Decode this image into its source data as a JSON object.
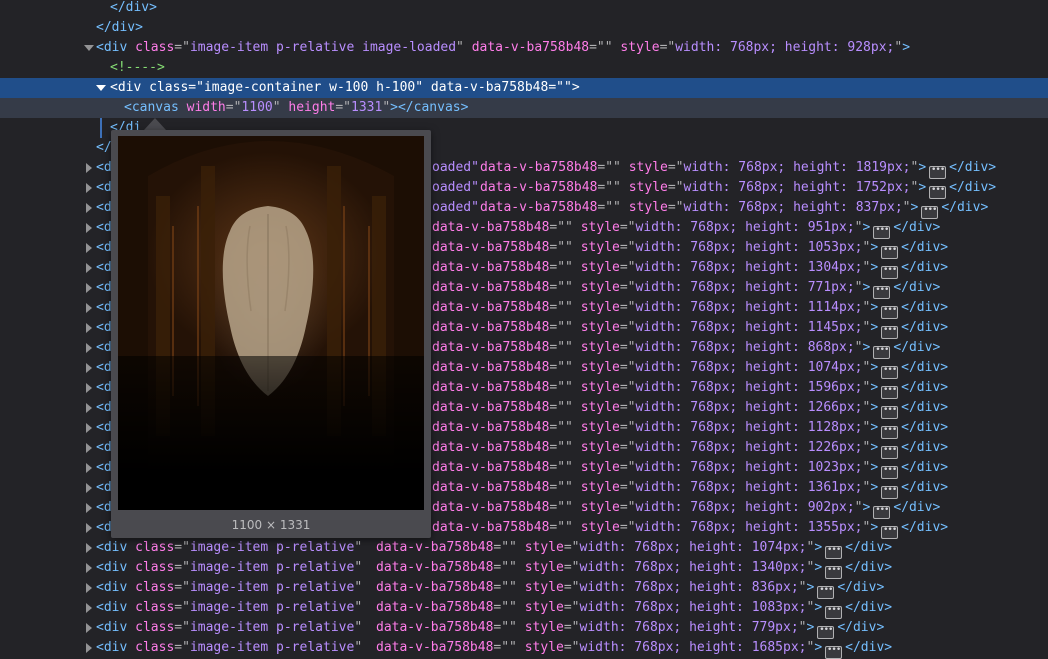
{
  "markup": {
    "close_tag": "</div>",
    "open_div": "<div",
    "gt": ">",
    "eq_q": "=\"",
    "q": "\"",
    "sp": " ",
    "ellipsis": "•••",
    "class_attr": "class",
    "dv_attr": "data-v-ba758b48",
    "empty_val": "=\"\"",
    "style_attr": "style",
    "width_attr": "width",
    "height_attr": "height",
    "canvas_open": "<canvas",
    "canvas_close": "</canvas>",
    "comment_text": "<!---->"
  },
  "expanded_item": {
    "class_value": "image-item p-relative image-loaded",
    "style_value": "width: 768px; height: 928px;"
  },
  "container": {
    "class_value": "image-container w-100 h-100"
  },
  "canvas": {
    "width_value": "1100",
    "height_value": "1331"
  },
  "partial_lines": {
    "inner_close": "</di",
    "outer_close": "</"
  },
  "visible_loaded_rows": [
    {
      "class_tail": "oaded\"",
      "style_value": "width: 768px; height: 1819px;"
    },
    {
      "class_tail": "oaded\"",
      "style_value": "width: 768px; height: 1752px;"
    },
    {
      "class_tail": "oaded\"",
      "style_value": "width: 768px; height: 837px;"
    }
  ],
  "hidden_rows": [
    {
      "style_value": "width: 768px; height: 951px;"
    },
    {
      "style_value": "width: 768px; height: 1053px;"
    },
    {
      "style_value": "width: 768px; height: 1304px;"
    },
    {
      "style_value": "width: 768px; height: 771px;"
    },
    {
      "style_value": "width: 768px; height: 1114px;"
    },
    {
      "style_value": "width: 768px; height: 1145px;"
    },
    {
      "style_value": "width: 768px; height: 868px;"
    },
    {
      "style_value": "width: 768px; height: 1074px;"
    },
    {
      "style_value": "width: 768px; height: 1596px;"
    },
    {
      "style_value": "width: 768px; height: 1266px;"
    },
    {
      "style_value": "width: 768px; height: 1128px;"
    },
    {
      "style_value": "width: 768px; height: 1226px;"
    },
    {
      "style_value": "width: 768px; height: 1023px;"
    },
    {
      "style_value": "width: 768px; height: 1361px;"
    },
    {
      "style_value": "width: 768px; height: 902px;"
    },
    {
      "style_value": "width: 768px; height: 1355px;"
    }
  ],
  "full_rows": [
    {
      "class_value": "image-item p-relative",
      "style_value": "width: 768px; height: 1074px;"
    },
    {
      "class_value": "image-item p-relative",
      "style_value": "width: 768px; height: 1340px;"
    },
    {
      "class_value": "image-item p-relative",
      "style_value": "width: 768px; height: 836px;"
    },
    {
      "class_value": "image-item p-relative",
      "style_value": "width: 768px; height: 1083px;"
    },
    {
      "class_value": "image-item p-relative",
      "style_value": "width: 768px; height: 779px;"
    },
    {
      "class_value": "image-item p-relative",
      "style_value": "width: 768px; height: 1685px;"
    }
  ],
  "tooltip": {
    "size_label": "1100 × 1331"
  },
  "colors": {
    "background": "#232327",
    "selection": "#204e8a",
    "tag": "#75bfff",
    "attribute": "#ff7de9",
    "value": "#b98eff",
    "comment": "#86de74"
  }
}
